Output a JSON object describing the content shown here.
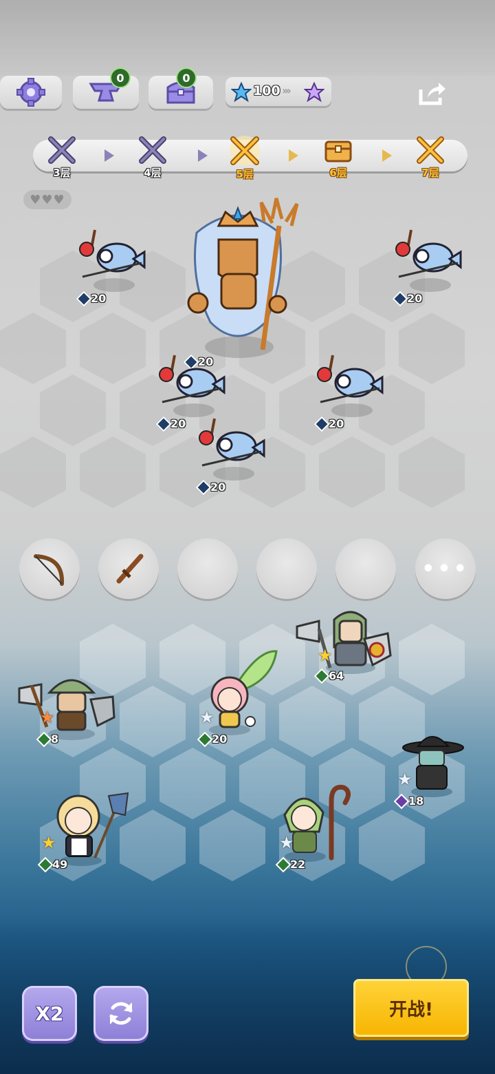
{
  "topbar": {
    "settings_icon": "gear-icon",
    "anvil_count": "0",
    "chest_count": "0",
    "star_count": "100",
    "share_icon": "share-icon"
  },
  "floors": [
    {
      "label": "3层",
      "icon": "crossed-swords-icon",
      "state": "cleared"
    },
    {
      "label": "4层",
      "icon": "crossed-swords-icon",
      "state": "cleared"
    },
    {
      "label": "5层",
      "icon": "crossed-swords-icon",
      "state": "current"
    },
    {
      "label": "6层",
      "icon": "treasure-chest-icon",
      "state": "upcoming"
    },
    {
      "label": "7层",
      "icon": "crossed-swords-icon",
      "state": "upcoming"
    }
  ],
  "lives_icon": "hearts-icon",
  "enemies": [
    {
      "name": "fish-knight",
      "level": "20"
    },
    {
      "name": "fish-knight",
      "level": "20"
    },
    {
      "name": "sea-king-boss",
      "level": "20"
    },
    {
      "name": "fish-knight",
      "level": "20"
    },
    {
      "name": "fish-knight",
      "level": "20"
    },
    {
      "name": "fish-knight",
      "level": "20"
    }
  ],
  "item_slots": [
    {
      "icon": "bow-icon"
    },
    {
      "icon": "dagger-icon"
    },
    {
      "icon": ""
    },
    {
      "icon": ""
    },
    {
      "icon": ""
    },
    {
      "icon": "more-dots-icon"
    }
  ],
  "heroes": [
    {
      "name": "green-knight",
      "level": "64",
      "star": "gold"
    },
    {
      "name": "mushroom-warrior",
      "level": "8",
      "star": "orange"
    },
    {
      "name": "leaf-fairy",
      "level": "20",
      "star": "white"
    },
    {
      "name": "hat-mage",
      "level": "18",
      "star": "white"
    },
    {
      "name": "maid",
      "level": "49",
      "star": "gold"
    },
    {
      "name": "staff-elf",
      "level": "22",
      "star": "white"
    }
  ],
  "buttons": {
    "speed": "X2",
    "refresh_icon": "refresh-icon",
    "fight": "开战!"
  },
  "colors": {
    "gold": "#ffc23a",
    "purple": "#8c7ed6",
    "fight_yellow": "#f7b400"
  }
}
